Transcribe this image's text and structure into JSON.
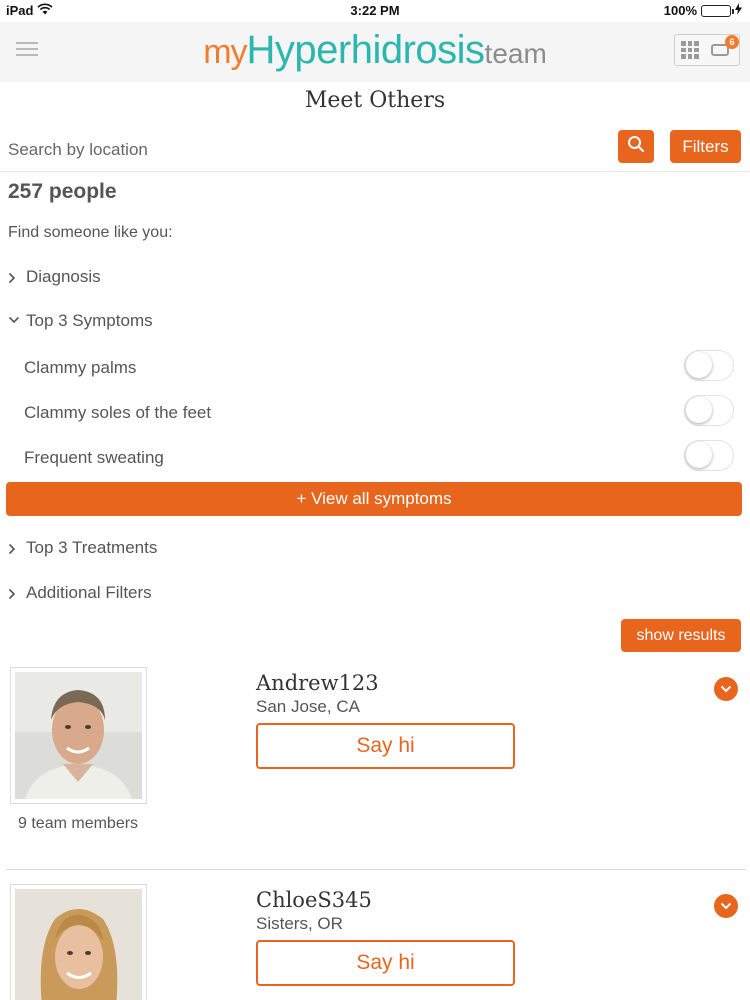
{
  "status_bar": {
    "device": "iPad",
    "time": "3:22 PM",
    "battery": "100%"
  },
  "header": {
    "logo_my": "my",
    "logo_main": "Hyperhidrosis",
    "logo_team": "team",
    "notification_count": "6"
  },
  "page": {
    "title": "Meet Others"
  },
  "search": {
    "placeholder": "Search by location",
    "filters_label": "Filters"
  },
  "results": {
    "count_label": "257 people",
    "find_label": "Find someone like you:"
  },
  "filters": {
    "diagnosis": "Diagnosis",
    "top_symptoms": "Top 3 Symptoms",
    "symptoms": [
      {
        "label": "Clammy palms",
        "on": false
      },
      {
        "label": "Clammy soles of the feet",
        "on": false
      },
      {
        "label": "Frequent sweating",
        "on": false
      }
    ],
    "view_all_label": "+ View all symptoms",
    "top_treatments": "Top 3 Treatments",
    "additional": "Additional Filters",
    "show_results_label": "show results"
  },
  "members": [
    {
      "name": "Andrew123",
      "location": "San Jose, CA",
      "say_hi": "Say hi",
      "team_members": "9 team members"
    },
    {
      "name": "ChloeS345",
      "location": "Sisters, OR",
      "say_hi": "Say hi"
    }
  ],
  "colors": {
    "accent": "#e8651e",
    "logo_orange": "#f07d2e",
    "logo_teal": "#2bb6ae"
  },
  "icons": [
    "hamburger-menu-icon",
    "apps-grid-icon",
    "chat-icon",
    "search-icon",
    "chevron-right-icon",
    "chevron-down-icon",
    "expand-chevron-icon"
  ]
}
